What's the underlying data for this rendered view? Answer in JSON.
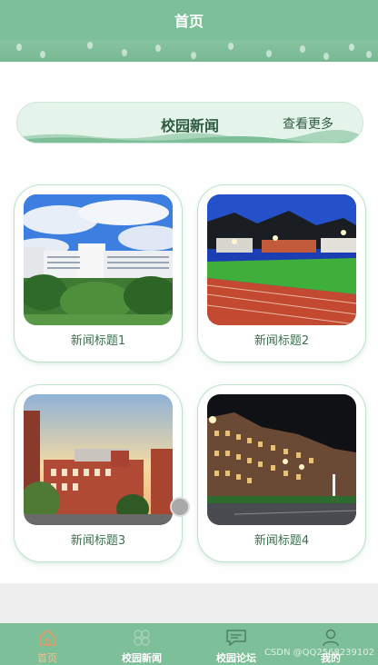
{
  "header": {
    "title": "首页"
  },
  "section": {
    "title": "校园新闻",
    "more_label": "查看更多"
  },
  "news": [
    {
      "title": "新闻标题1"
    },
    {
      "title": "新闻标题2"
    },
    {
      "title": "新闻标题3"
    },
    {
      "title": "新闻标题4"
    }
  ],
  "tabbar": {
    "items": [
      {
        "label": "首页",
        "icon": "home-icon",
        "active": true
      },
      {
        "label": "校园新闻",
        "icon": "clover-icon",
        "active": false
      },
      {
        "label": "校园论坛",
        "icon": "chat-icon",
        "active": false
      },
      {
        "label": "我的",
        "icon": "user-icon",
        "active": false
      }
    ]
  },
  "watermark": "CSDN @QQ2568239102",
  "colors": {
    "brand_green": "#7dbf98",
    "active_tab": "#f4c08a",
    "text_green": "#3e6f52"
  }
}
